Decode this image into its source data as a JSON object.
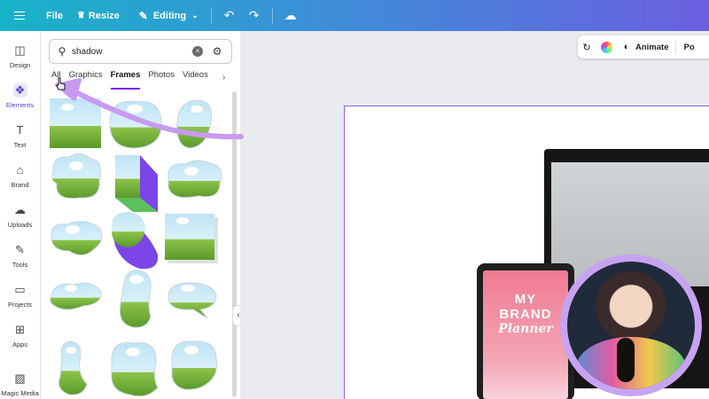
{
  "topbar": {
    "file": "File",
    "resize": "Resize",
    "editing": "Editing"
  },
  "rail": {
    "items": [
      {
        "label": "Design",
        "icon": "design-icon"
      },
      {
        "label": "Elements",
        "icon": "elements-icon"
      },
      {
        "label": "Text",
        "icon": "text-icon"
      },
      {
        "label": "Brand",
        "icon": "brand-icon"
      },
      {
        "label": "Uploads",
        "icon": "uploads-icon"
      },
      {
        "label": "Tools",
        "icon": "tools-icon"
      },
      {
        "label": "Projects",
        "icon": "projects-icon"
      },
      {
        "label": "Apps",
        "icon": "apps-icon"
      },
      {
        "label": "Magic Media",
        "icon": "magic-media-icon"
      }
    ]
  },
  "panel": {
    "search_value": "shadow",
    "tabs": [
      "All",
      "Graphics",
      "Frames",
      "Photos",
      "Videos"
    ],
    "active_tab": "Frames"
  },
  "canvas": {
    "animate": "Animate",
    "position_partial": "Po",
    "tablet_line1": "MY",
    "tablet_line2": "BRAND",
    "tablet_line3": "Planner"
  },
  "colors": {
    "accent": "#7d2ae8",
    "annotation": "#c89af0"
  }
}
